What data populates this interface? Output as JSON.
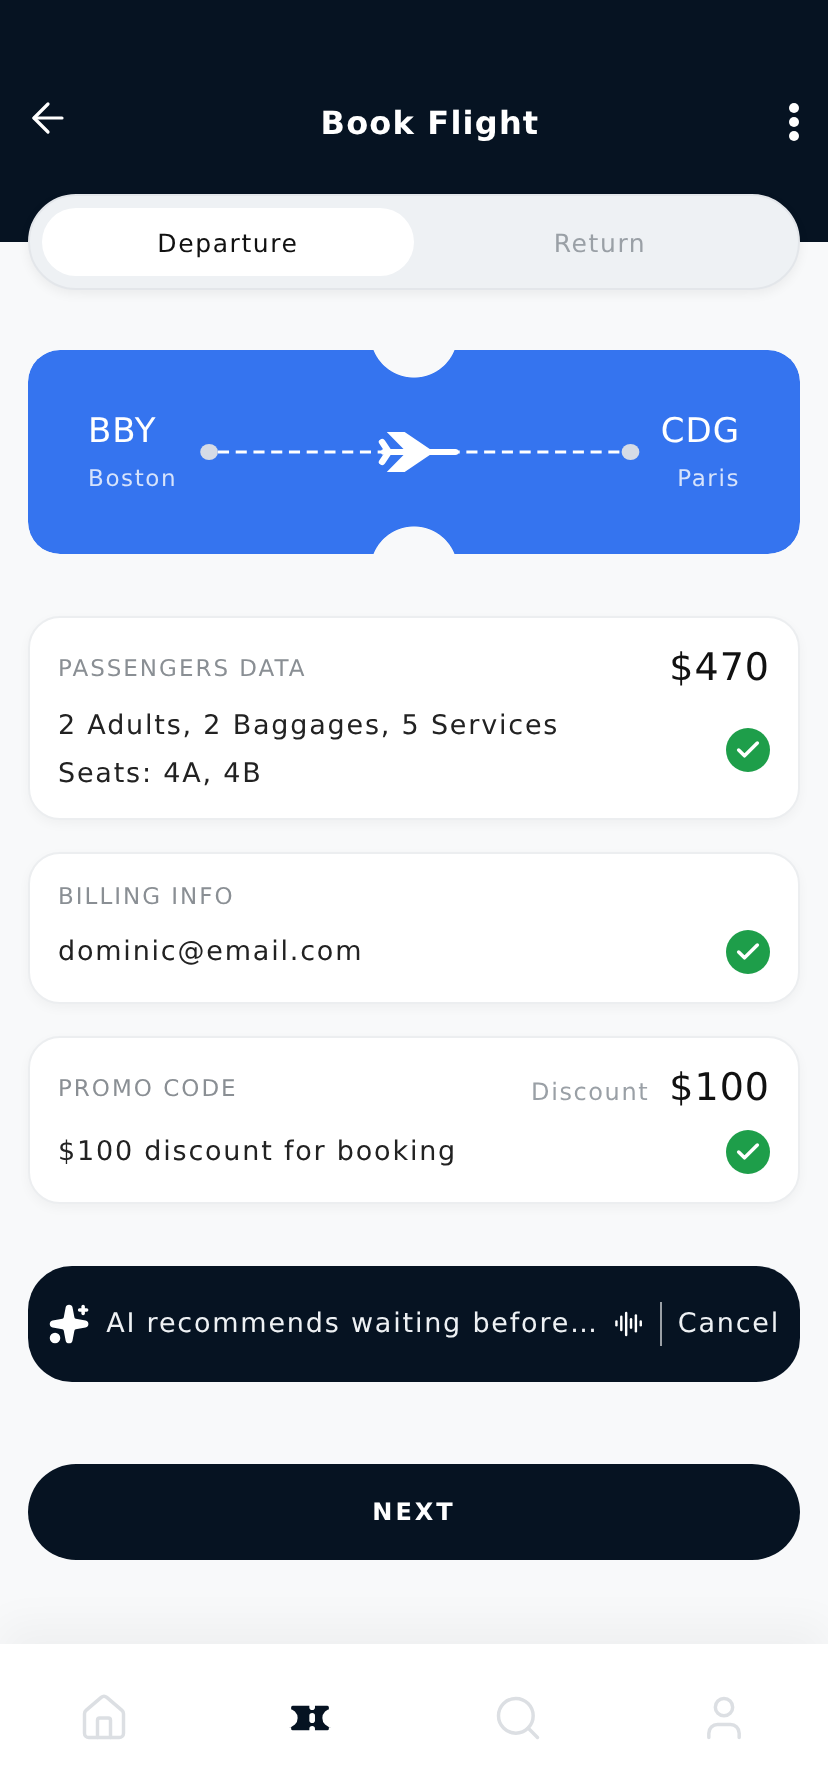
{
  "header": {
    "title": "Book Flight"
  },
  "tabs": [
    {
      "label": "Departure",
      "selected": true
    },
    {
      "label": "Return",
      "selected": false
    }
  ],
  "flight": {
    "from_code": "BBY",
    "from_city": "Boston",
    "to_code": "CDG",
    "to_city": "Paris"
  },
  "cards": [
    {
      "title": "PASSENGERS DATA",
      "price": "$470",
      "lines": [
        "2 Adults, 2 Baggages, 5 Services",
        "Seats: 4A, 4B"
      ],
      "checked": true
    },
    {
      "title": "BILLING INFO",
      "lines": [
        "dominic@email.com"
      ],
      "checked": true
    },
    {
      "title": "PROMO CODE",
      "price_label": "Discount",
      "price": "$100",
      "lines": [
        "$100 discount for booking"
      ],
      "checked": true
    }
  ],
  "ai_banner": {
    "text": "AI recommends waiting before…",
    "action": "Cancel"
  },
  "next_button": "NEXT",
  "nav": [
    {
      "kind": "home",
      "selected": false
    },
    {
      "kind": "tickets",
      "selected": true
    },
    {
      "kind": "search",
      "selected": false
    },
    {
      "kind": "profile",
      "selected": false
    }
  ]
}
